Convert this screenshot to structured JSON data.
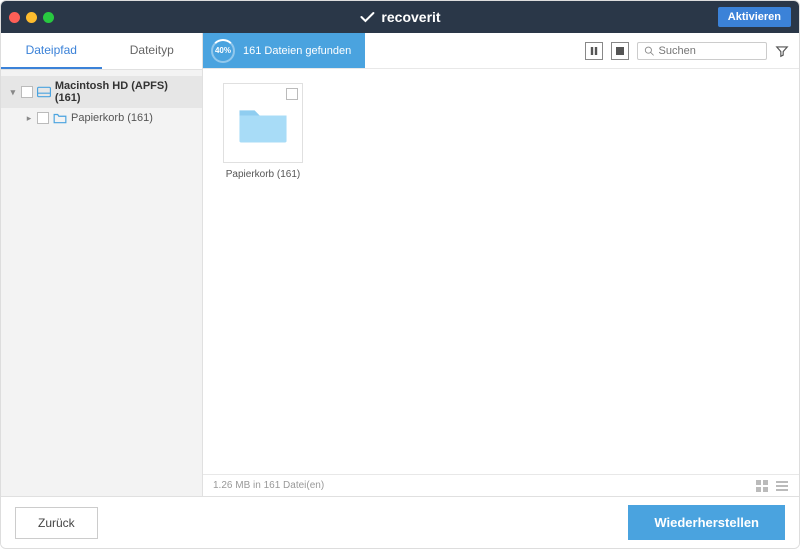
{
  "titlebar": {
    "brand": "recoverit",
    "activate": "Aktivieren"
  },
  "sidebar": {
    "tabs": {
      "path": "Dateipfad",
      "type": "Dateityp"
    },
    "tree": {
      "root": "Macintosh HD (APFS) (161)",
      "child": "Papierkorb (161)"
    }
  },
  "toolbar": {
    "progress_pct": "40%",
    "status_text": "161 Dateien gefunden",
    "search_placeholder": "Suchen"
  },
  "content": {
    "folder1_label": "Papierkorb (161)"
  },
  "statusbar": {
    "summary": "1.26 MB in 161 Datei(en)"
  },
  "footer": {
    "back": "Zurück",
    "recover": "Wiederherstellen"
  },
  "colors": {
    "accent": "#4aa3df",
    "header": "#2a3748"
  }
}
